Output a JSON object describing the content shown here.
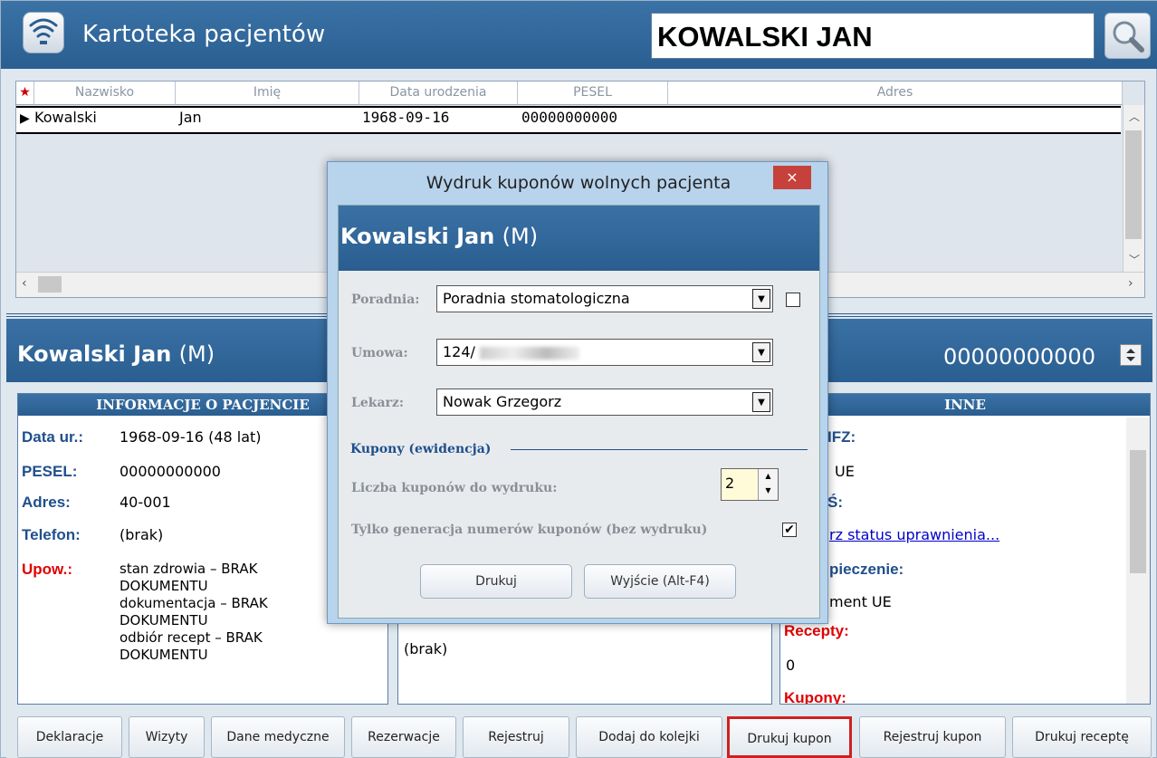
{
  "app": {
    "title": "Kartoteka pacjentów",
    "search_value": "KOWALSKI JAN"
  },
  "grid": {
    "columns": [
      "Nazwisko",
      "Imię",
      "Data urodzenia",
      "PESEL",
      "Adres"
    ],
    "rows": [
      {
        "nazwisko": "Kowalski",
        "imie": "Jan",
        "data": "1968-09-16",
        "pesel": "00000000000",
        "adres": ""
      }
    ]
  },
  "patient": {
    "name": "Kowalski Jan",
    "sex": "(M)",
    "pesel": "00000000000"
  },
  "info_panel": {
    "header": "INFORMACJE O PACJENCIE",
    "data_label": "Data ur.:",
    "data_value": "1968-09-16 (48 lat)",
    "pesel_label": "PESEL:",
    "pesel_value": "00000000000",
    "adres_label": "Adres:",
    "adres_value": "40-001",
    "telefon_label": "Telefon:",
    "telefon_value": "(brak)",
    "upow_label": "Upow.:",
    "upow_lines": [
      "stan zdrowia – BRAK",
      "DOKUMENTU",
      "dokumentacja – BRAK",
      "DOKUMENTU",
      "odbiór recept – BRAK",
      "DOKUMENTU"
    ]
  },
  "middle_panel": {
    "value": "(brak)"
  },
  "inne_panel": {
    "header": "INNE",
    "line1": "IFZ:",
    "line2": "UE",
    "line3": "Ś:",
    "link": "rz status uprawnienia...",
    "line5": "pieczenie:",
    "line6": "ment UE",
    "recepty_label": "Recepty:",
    "recepty_value": "0",
    "kupony_label": "Kupony:"
  },
  "buttons": [
    "Deklaracje",
    "Wizyty",
    "Dane medyczne",
    "Rezerwacje",
    "Rejestruj",
    "Dodaj do kolejki",
    "Drukuj kupon",
    "Rejestruj kupon",
    "Drukuj receptę"
  ],
  "dialog": {
    "title": "Wydruk kuponów wolnych pacjenta",
    "close": "×",
    "patient_name": "Kowalski Jan",
    "patient_sex": "(M)",
    "poradnia_label": "Poradnia:",
    "poradnia_value": "Poradnia stomatologiczna",
    "umowa_label": "Umowa:",
    "umowa_value": "124/",
    "lekarz_label": "Lekarz:",
    "lekarz_value": "Nowak Grzegorz",
    "section": "Kupony (ewidencja)",
    "liczba_label": "Liczba kuponów do wydruku:",
    "liczba_value": "2",
    "tylko_label": "Tylko generacja numerów kuponów (bez wydruku)",
    "print_button": "Drukuj",
    "exit_button": "Wyjście (Alt-F4)"
  }
}
